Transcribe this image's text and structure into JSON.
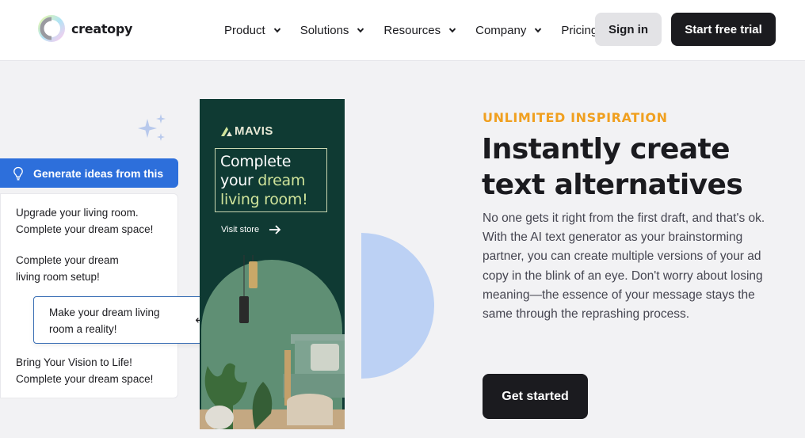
{
  "header": {
    "logo_text": "creatopy",
    "nav": [
      {
        "label": "Product",
        "has_dropdown": true
      },
      {
        "label": "Solutions",
        "has_dropdown": true
      },
      {
        "label": "Resources",
        "has_dropdown": true
      },
      {
        "label": "Company",
        "has_dropdown": true
      },
      {
        "label": "Pricing",
        "has_dropdown": false
      }
    ],
    "signin_label": "Sign in",
    "trial_label": "Start free trial"
  },
  "ideas_widget": {
    "generate_label": "Generate ideas from this",
    "ideas": [
      {
        "line1": "Upgrade your living room.",
        "line2": "Complete your dream space!"
      },
      {
        "line1": "Complete your dream",
        "line2": "living room setup!"
      },
      {
        "line1": "Bring Your Vision to Life!",
        "line2": "Complete your dream space!"
      }
    ],
    "selected_idea": {
      "line1": "Make your dream living",
      "line2": "room a reality!"
    },
    "enter_icon": "↵"
  },
  "ad": {
    "brand": "MAVIS",
    "headline_line1": "Complete",
    "headline_line2_pre": "your ",
    "headline_line2_hl": "dream",
    "headline_line3": "living room!",
    "cta": "Visit store",
    "colors": {
      "background": "#0f3a33",
      "highlight": "#cfe39a"
    }
  },
  "hero": {
    "eyebrow": "UNLIMITED INSPIRATION",
    "headline_line1": "Instantly create",
    "headline_line2": "text alternatives",
    "body": "No one gets it right from the first draft, and that's ok. With the AI text generator as your brainstorming partner, you can create multiple versions of your ad copy in the blink of an eye. Don't worry about losing meaning—the essence of your message stays the same through the reprashing process.",
    "cta_label": "Get started"
  },
  "colors": {
    "accent_blue": "#2d6fdb",
    "eyebrow_orange": "#f0a020",
    "dark": "#1b1b1f",
    "half_circle": "#bcd1f4"
  }
}
